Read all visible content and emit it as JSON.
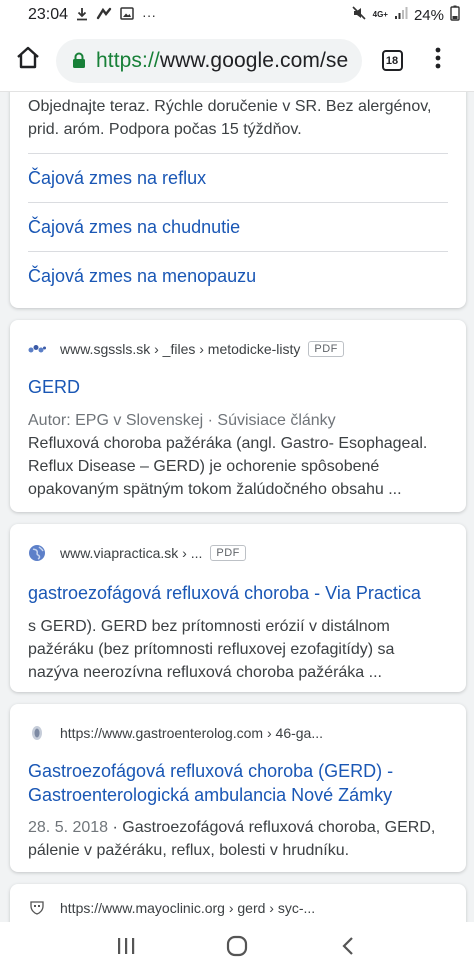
{
  "status_bar": {
    "time": "23:04",
    "network": "4G+",
    "battery": "24%",
    "more_indicator": "···"
  },
  "browser": {
    "url_scheme": "https://",
    "url_rest": "www.google.com/se",
    "tab_count": "18"
  },
  "top_card": {
    "snippet_line1": "Objednajte teraz. Rýchle doručenie v SR. Bez alergénov,",
    "snippet_line2": "prid. aróm. Podpora počas 15 týždňov.",
    "links": [
      "Čajová zmes na reflux",
      "Čajová zmes na chudnutie",
      "Čajová zmes na menopauzu"
    ]
  },
  "results": [
    {
      "source": "www.sgssls.sk › _files › metodicke-listy",
      "badge": "PDF",
      "title": "GERD",
      "meta": "Autor: EPG v Slovenskej · Súvisiace články",
      "snippet": "Refluxová choroba pažéráka (angl. Gastro- Esophageal. Reflux Disease – GERD) je ochorenie spôsobené opakovaným spätným tokom žalúdočného obsahu ..."
    },
    {
      "source": "www.viapractica.sk › ...",
      "badge": "PDF",
      "title": "gastroezofágová refluxová choroba - Via Practica",
      "snippet": "s GERD). GERD bez prítomnosti erózií v distálnom pažéráku (bez prítomnosti refluxovej ezofagitídy) sa nazýva neerozívna refluxová choroba pažéráka ..."
    },
    {
      "source": "https://www.gastroenterolog.com › 46-ga...",
      "title": "Gastroezofágová refluxová choroba (GERD) - Gastroenterologická ambulancia Nové Zámky",
      "date": "28. 5. 2018",
      "snippet": " · Gastroezofágová refluxová choroba, GERD, pálenie v pažéráku, reflux, bolesti v hrudníku."
    },
    {
      "source": "https://www.mayoclinic.org › gerd › syc-..."
    }
  ],
  "colors": {
    "link": "#1a57b5",
    "secure": "#188038",
    "background": "#f1f3f4"
  },
  "icons": [
    "download-icon",
    "sync-icon",
    "image-icon",
    "mute-icon",
    "signal-icon",
    "battery-icon",
    "home-icon",
    "lock-icon",
    "tabs-icon",
    "more-vert-icon",
    "recents-icon",
    "home-nav-icon",
    "back-icon"
  ]
}
